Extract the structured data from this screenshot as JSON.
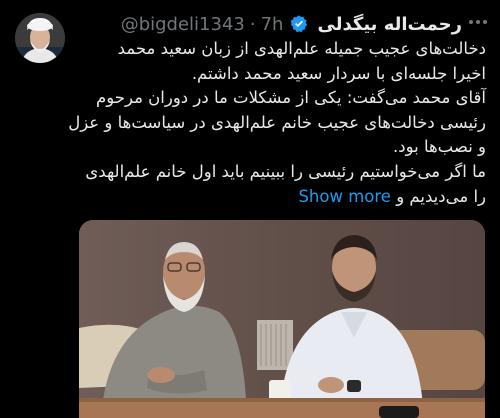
{
  "author": {
    "display_name": "رحمت‌اله بیگدلی",
    "handle": "@bigdeli1343",
    "separator": "·",
    "time": "7h"
  },
  "tweet": {
    "lines": [
      "دخالت‌های عجیب جمیله علم‌الهدی از زبان سعید محمد",
      "اخیرا جلسه‌ای با سردار سعید محمد داشتم.",
      "آقای محمد می‌گفت: یکی از مشکلات ما در دوران مرحوم",
      "رئیسی دخالت‌های عجیب خانم علم‌الهدی در سیاست‌ها و عزل",
      "و نصب‌ها بود.",
      "ما اگر می‌خواستیم رئیسی را ببینیم باید اول خانم علم‌الهدی"
    ],
    "last_line_text": "را می‌دیدیم و",
    "show_more_label": "Show more"
  },
  "icons": {
    "verified": "verified-badge-icon",
    "more": "more-options-icon"
  },
  "colors": {
    "background": "#000000",
    "text": "#e7e9ea",
    "muted": "#71767b",
    "link": "#1d9bf0"
  }
}
